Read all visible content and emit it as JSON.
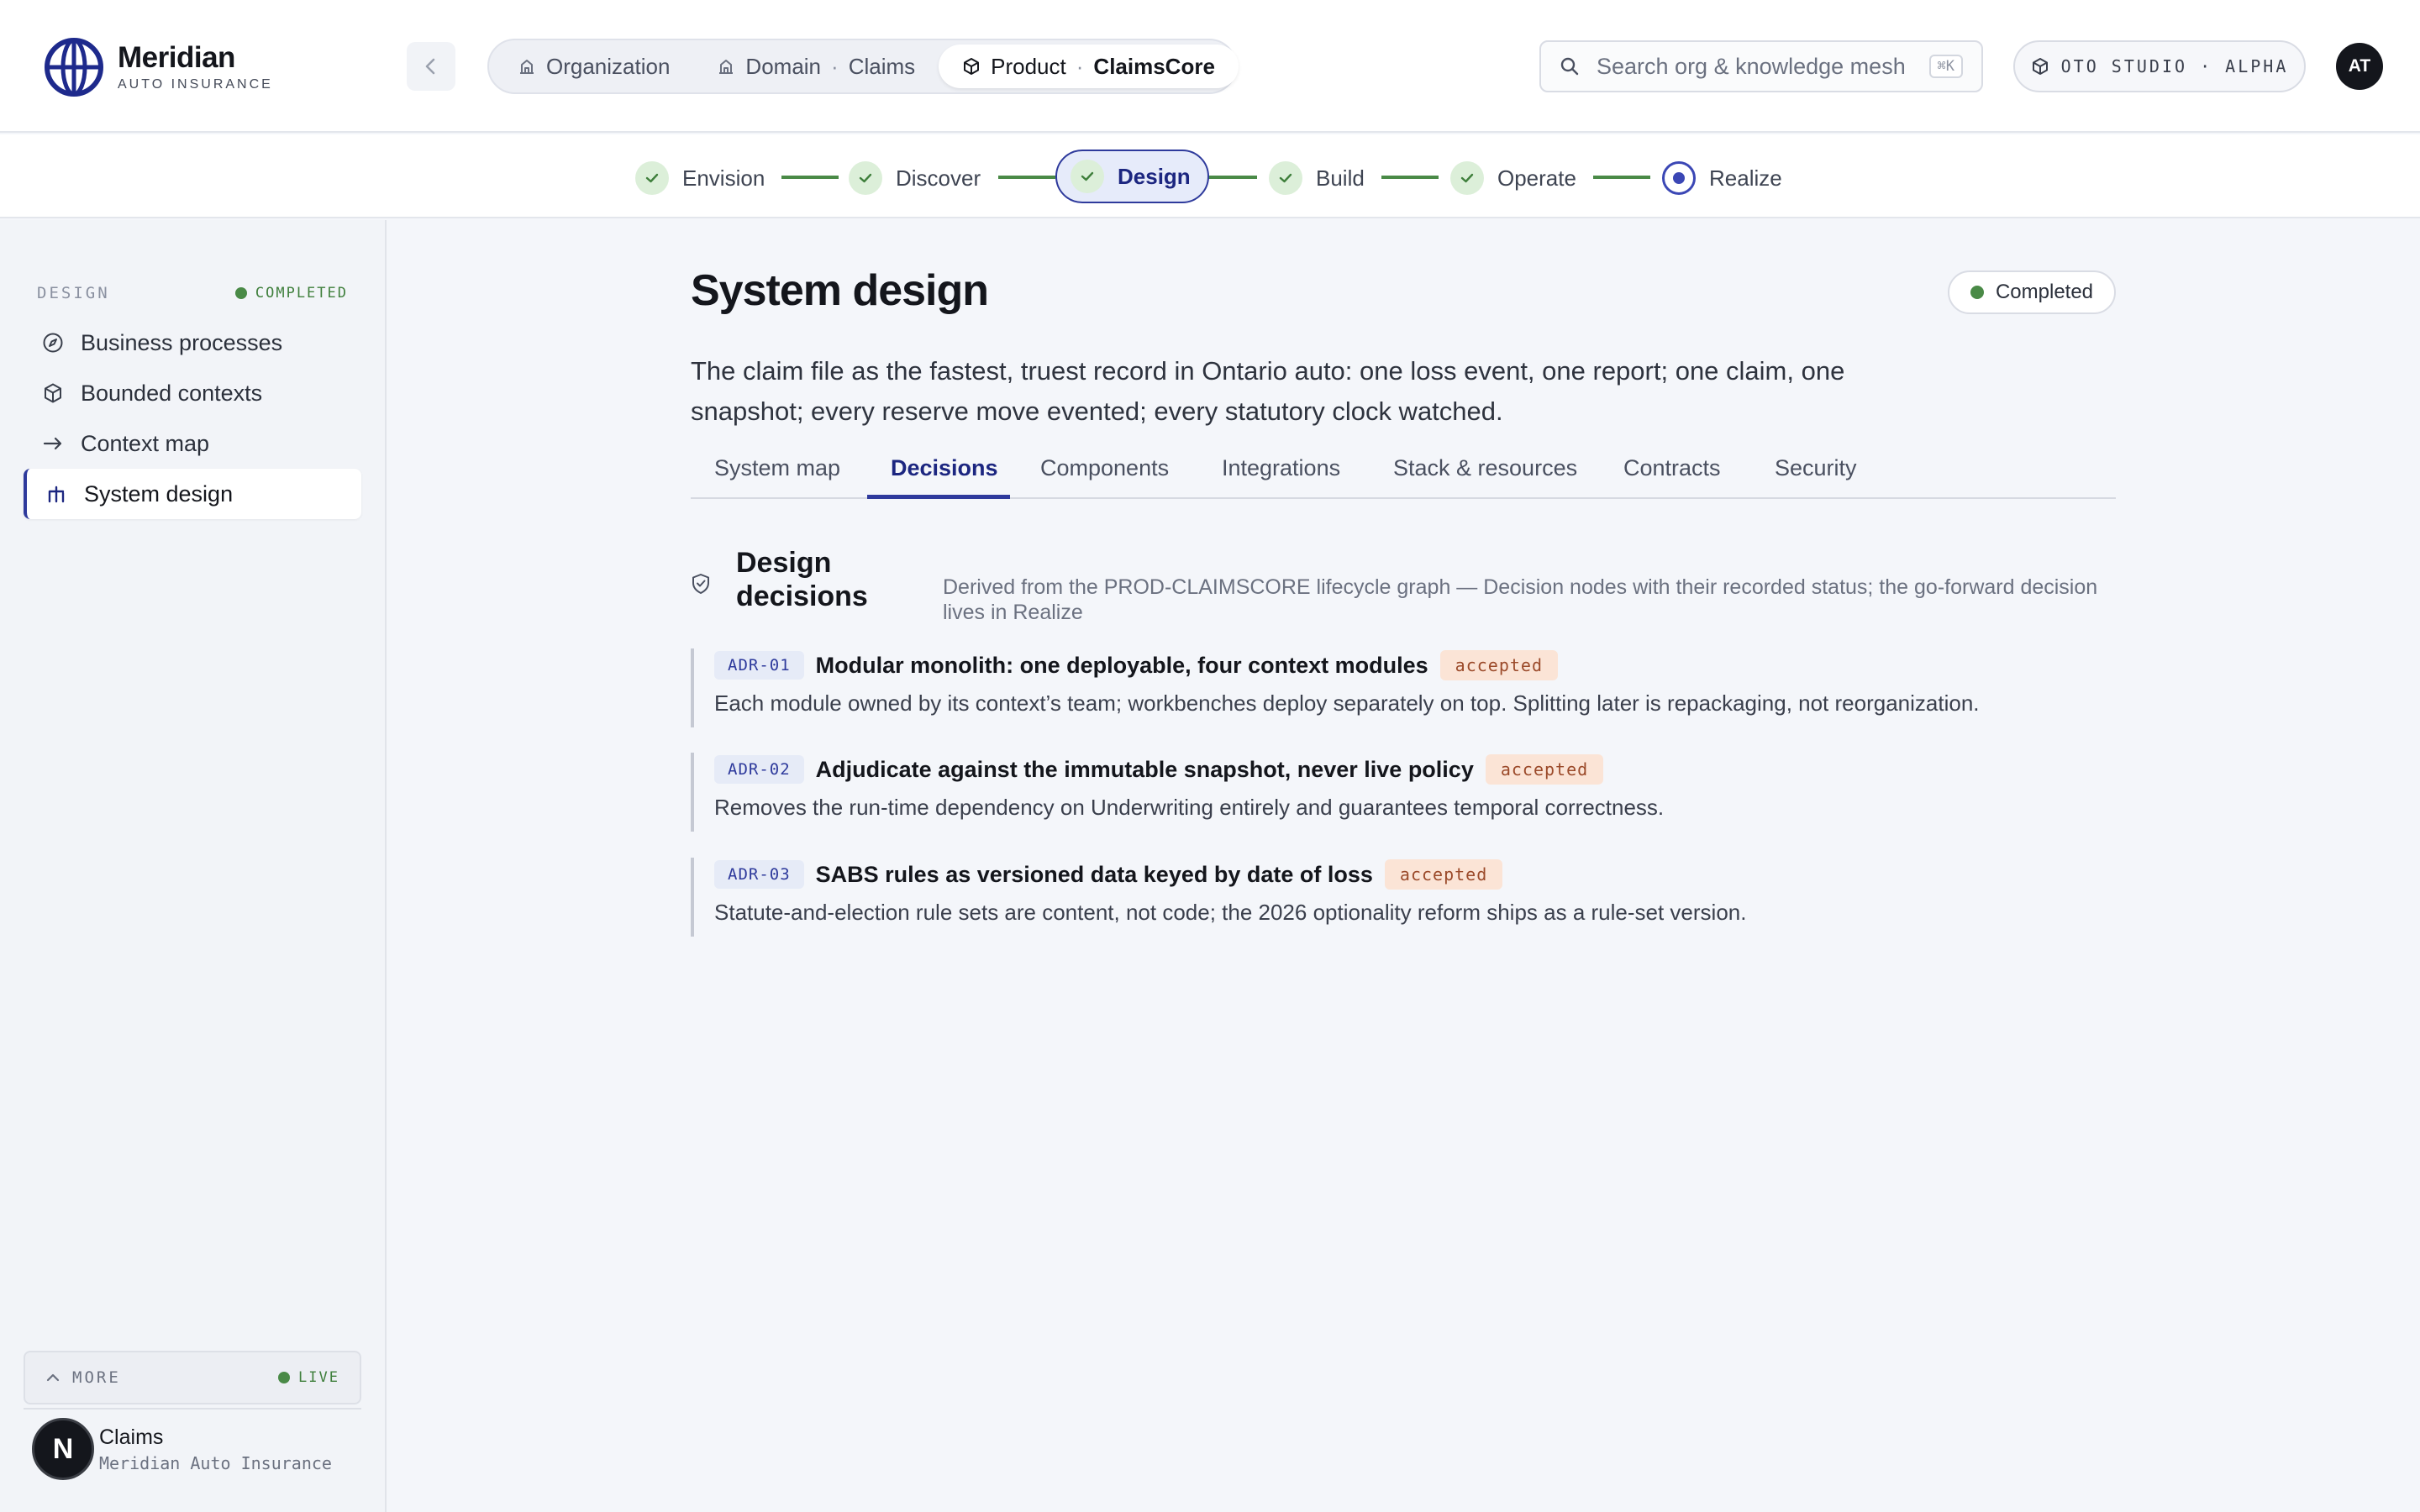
{
  "brand": {
    "name": "Meridian",
    "subtitle": "AUTO INSURANCE"
  },
  "breadcrumbs": [
    {
      "icon": "building-icon",
      "label": "Organization"
    },
    {
      "icon": "building-icon",
      "label": "Domain",
      "separator": "·",
      "value": "Claims"
    },
    {
      "icon": "cube-icon",
      "label": "Product",
      "separator": "·",
      "value": "ClaimsCore"
    }
  ],
  "search": {
    "placeholder": "Search org & knowledge mesh",
    "shortcut": "⌘K"
  },
  "studio": {
    "label": "OTO STUDIO · ALPHA"
  },
  "user": {
    "initials": "AT"
  },
  "stepper": {
    "steps": [
      {
        "label": "Envision",
        "state": "done"
      },
      {
        "label": "Discover",
        "state": "done"
      },
      {
        "label": "Design",
        "state": "current"
      },
      {
        "label": "Build",
        "state": "done"
      },
      {
        "label": "Operate",
        "state": "done"
      },
      {
        "label": "Realize",
        "state": "pending"
      }
    ],
    "connector_color": "#4a8a47",
    "accent_color": "#2e3a9c"
  },
  "sidebar": {
    "section_label": "DESIGN",
    "section_status": "COMPLETED",
    "items": [
      {
        "label": "Business processes",
        "icon": "compass-icon"
      },
      {
        "label": "Bounded contexts",
        "icon": "cube-icon"
      },
      {
        "label": "Context map",
        "icon": "arrow-right-icon"
      },
      {
        "label": "System design",
        "icon": "system-icon",
        "active": true
      }
    ],
    "more_label": "MORE",
    "live_label": "LIVE",
    "workspace": {
      "logo_letter": "N",
      "name": "Claims",
      "org": "Meridian Auto Insurance"
    }
  },
  "main": {
    "title": "System design",
    "status": "Completed",
    "subtitle": "The claim file as the fastest, truest record in Ontario auto: one loss event, one report; one claim, one snapshot; every reserve move evented; every statutory clock watched.",
    "tabs": [
      {
        "label": "System map"
      },
      {
        "label": "Decisions",
        "active": true
      },
      {
        "label": "Components"
      },
      {
        "label": "Integrations"
      },
      {
        "label": "Stack & resources"
      },
      {
        "label": "Contracts"
      },
      {
        "label": "Security"
      }
    ],
    "section": {
      "title": "Design decisions",
      "description": "Derived from the PROD-CLAIMSCORE lifecycle graph — Decision nodes with their recorded status; the go-forward decision lives in Realize"
    },
    "decisions": [
      {
        "id": "ADR-01",
        "title": "Modular monolith: one deployable, four context modules",
        "status": "accepted",
        "description": "Each module owned by its context’s team; workbenches deploy separately on top. Splitting later is repackaging, not reorganization."
      },
      {
        "id": "ADR-02",
        "title": "Adjudicate against the immutable snapshot, never live policy",
        "status": "accepted",
        "description": "Removes the run-time dependency on Underwriting entirely and guarantees temporal correctness."
      },
      {
        "id": "ADR-03",
        "title": "SABS rules as versioned data keyed by date of loss",
        "status": "accepted",
        "description": "Statute-and-election rule sets are content, not code; the 2026 optionality reform ships as a rule-set version."
      }
    ]
  }
}
